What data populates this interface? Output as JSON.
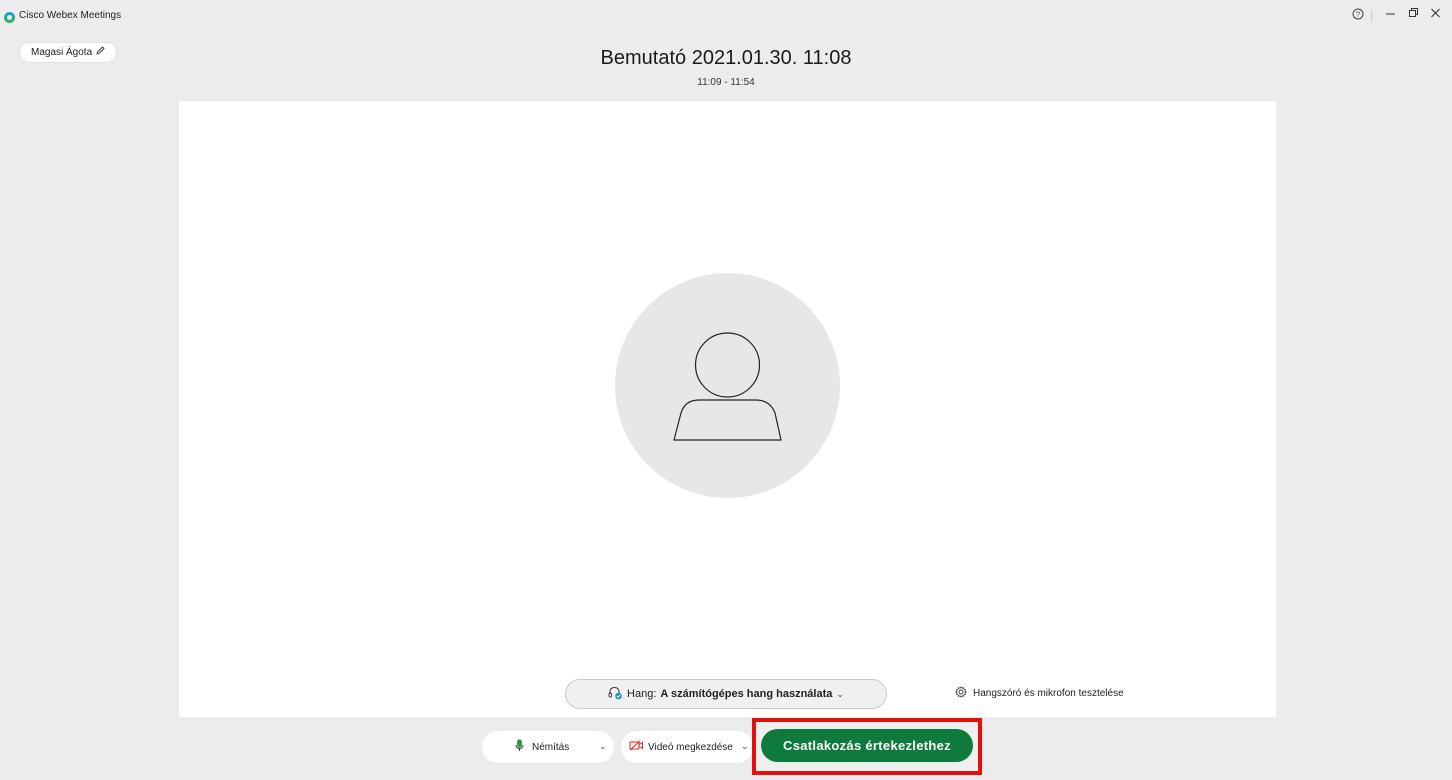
{
  "app": {
    "title": "Cisco Webex Meetings"
  },
  "window_controls": {
    "help": "?",
    "minimize": "–",
    "restore": "🗗",
    "close": "✕"
  },
  "user": {
    "name": "Magasi Ágota"
  },
  "meeting": {
    "title": "Bemutató 2021.01.30. 11:08",
    "time": "11:09 - 11:54"
  },
  "audio": {
    "label_prefix": "Hang:",
    "label_value": "A számítógépes hang használata"
  },
  "test_link": {
    "label": "Hangszóró és mikrofon tesztelése"
  },
  "controls": {
    "mute_label": "Némítás",
    "video_label": "Videó megkezdése",
    "join_label": "Csatlakozás értekezlethez"
  },
  "colors": {
    "join_button": "#0e7a3b",
    "highlight": "#e31010",
    "mic": "#2e9b3f",
    "video_off": "#e0201d"
  }
}
